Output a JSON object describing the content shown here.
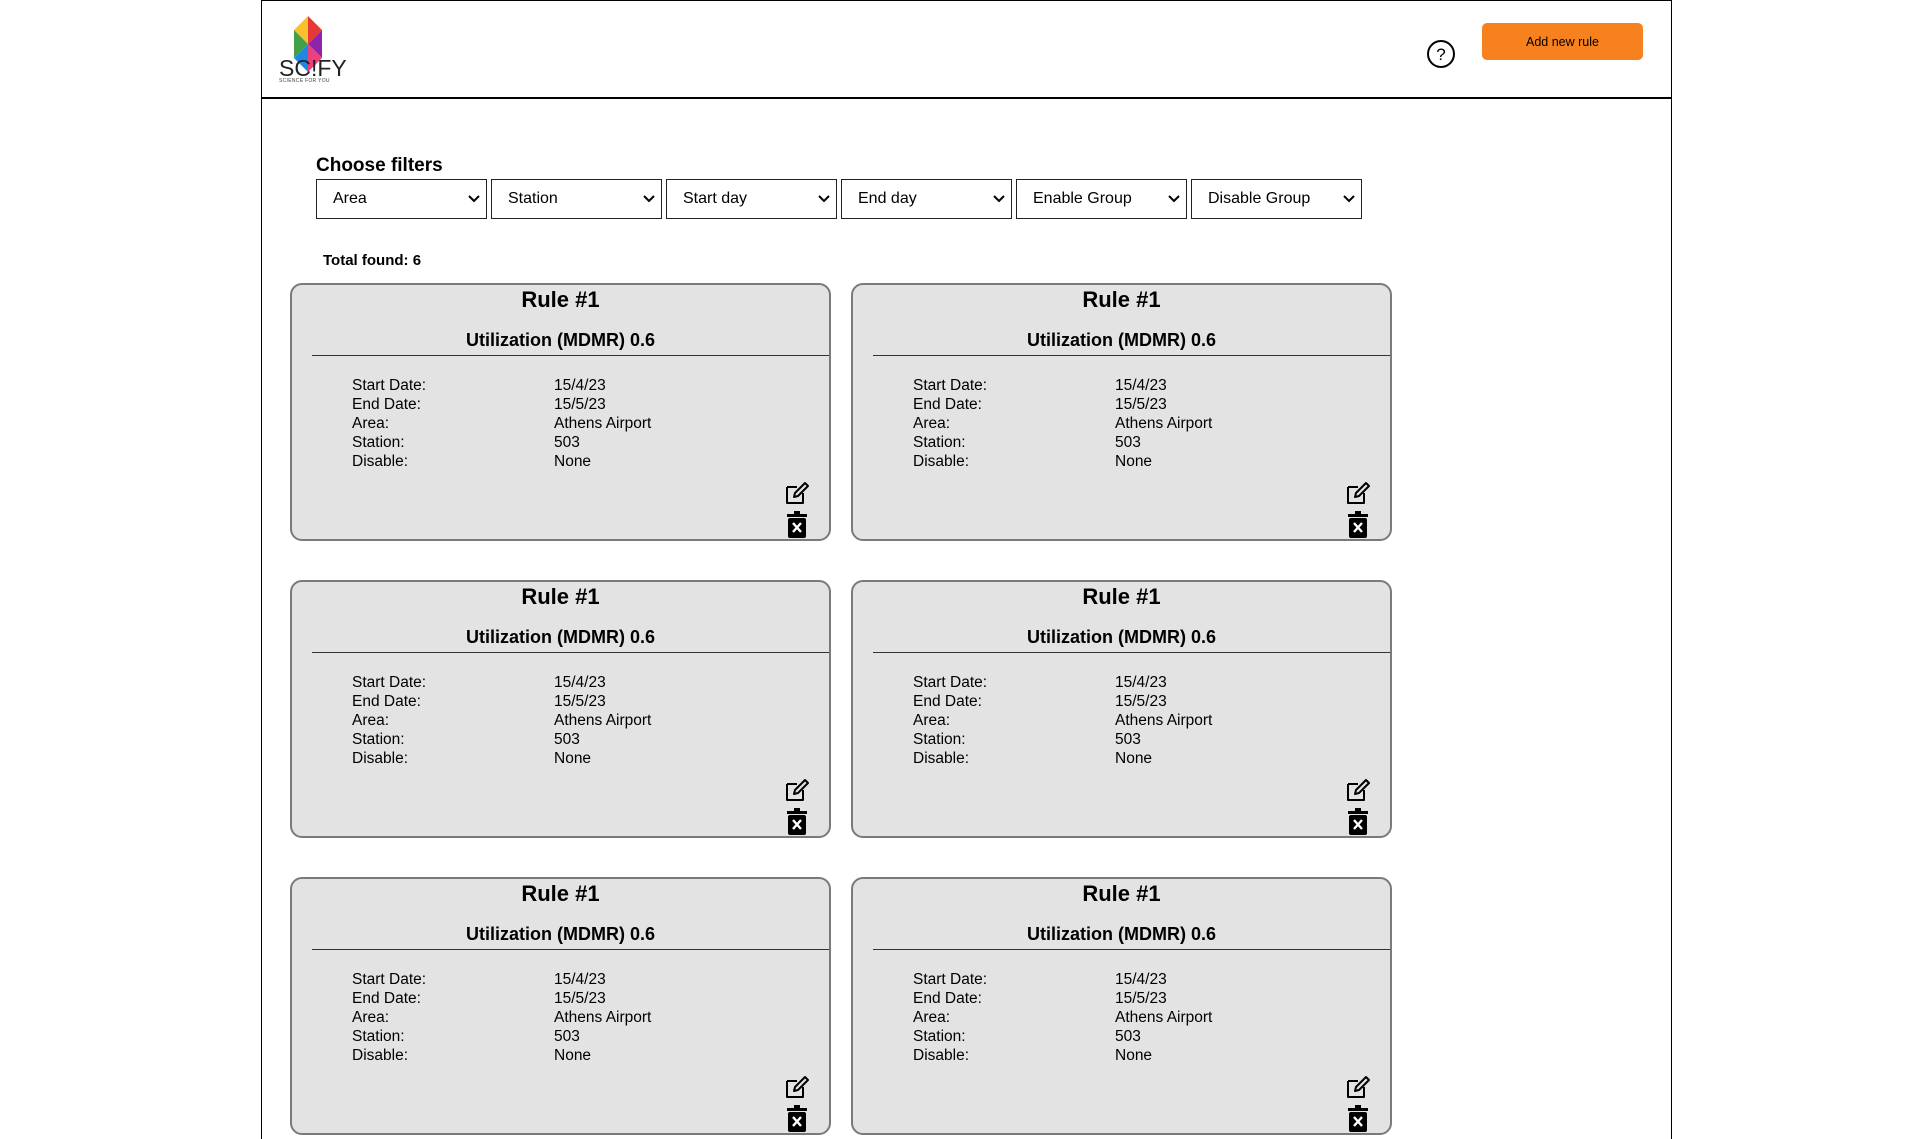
{
  "header": {
    "logo_text": "SC!FY",
    "logo_sub": "SCIENCE FOR YOU",
    "help_icon": "question-circle-icon",
    "add_button_label": "Add new rule",
    "accent_color": "#f7801f"
  },
  "filters": {
    "title": "Choose filters",
    "items": [
      "Area",
      "Station",
      "Start day",
      "End day",
      "Enable Group",
      "Disable Group"
    ]
  },
  "total_label": "Total found: 6",
  "cards": [
    {
      "title": "Rule #1",
      "subtitle": "Utilization (MDMR) 0.6",
      "start_label": "Start Date:",
      "start": "15/4/23",
      "end_label": "End Date:",
      "end": "15/5/23",
      "area_label": "Area:",
      "area": "Athens Airport",
      "station_label": "Station:",
      "station": "503",
      "disable_label": "Disable:",
      "disable": "None"
    },
    {
      "title": "Rule #1",
      "subtitle": "Utilization (MDMR) 0.6",
      "start_label": "Start Date:",
      "start": "15/4/23",
      "end_label": "End Date:",
      "end": "15/5/23",
      "area_label": "Area:",
      "area": "Athens Airport",
      "station_label": "Station:",
      "station": "503",
      "disable_label": "Disable:",
      "disable": "None"
    },
    {
      "title": "Rule #1",
      "subtitle": "Utilization (MDMR) 0.6",
      "start_label": "Start Date:",
      "start": "15/4/23",
      "end_label": "End Date:",
      "end": "15/5/23",
      "area_label": "Area:",
      "area": "Athens Airport",
      "station_label": "Station:",
      "station": "503",
      "disable_label": "Disable:",
      "disable": "None"
    },
    {
      "title": "Rule #1",
      "subtitle": "Utilization (MDMR) 0.6",
      "start_label": "Start Date:",
      "start": "15/4/23",
      "end_label": "End Date:",
      "end": "15/5/23",
      "area_label": "Area:",
      "area": "Athens Airport",
      "station_label": "Station:",
      "station": "503",
      "disable_label": "Disable:",
      "disable": "None"
    },
    {
      "title": "Rule #1",
      "subtitle": "Utilization (MDMR) 0.6",
      "start_label": "Start Date:",
      "start": "15/4/23",
      "end_label": "End Date:",
      "end": "15/5/23",
      "area_label": "Area:",
      "area": "Athens Airport",
      "station_label": "Station:",
      "station": "503",
      "disable_label": "Disable:",
      "disable": "None"
    },
    {
      "title": "Rule #1",
      "subtitle": "Utilization (MDMR) 0.6",
      "start_label": "Start Date:",
      "start": "15/4/23",
      "end_label": "End Date:",
      "end": "15/5/23",
      "area_label": "Area:",
      "area": "Athens Airport",
      "station_label": "Station:",
      "station": "503",
      "disable_label": "Disable:",
      "disable": "None"
    }
  ]
}
